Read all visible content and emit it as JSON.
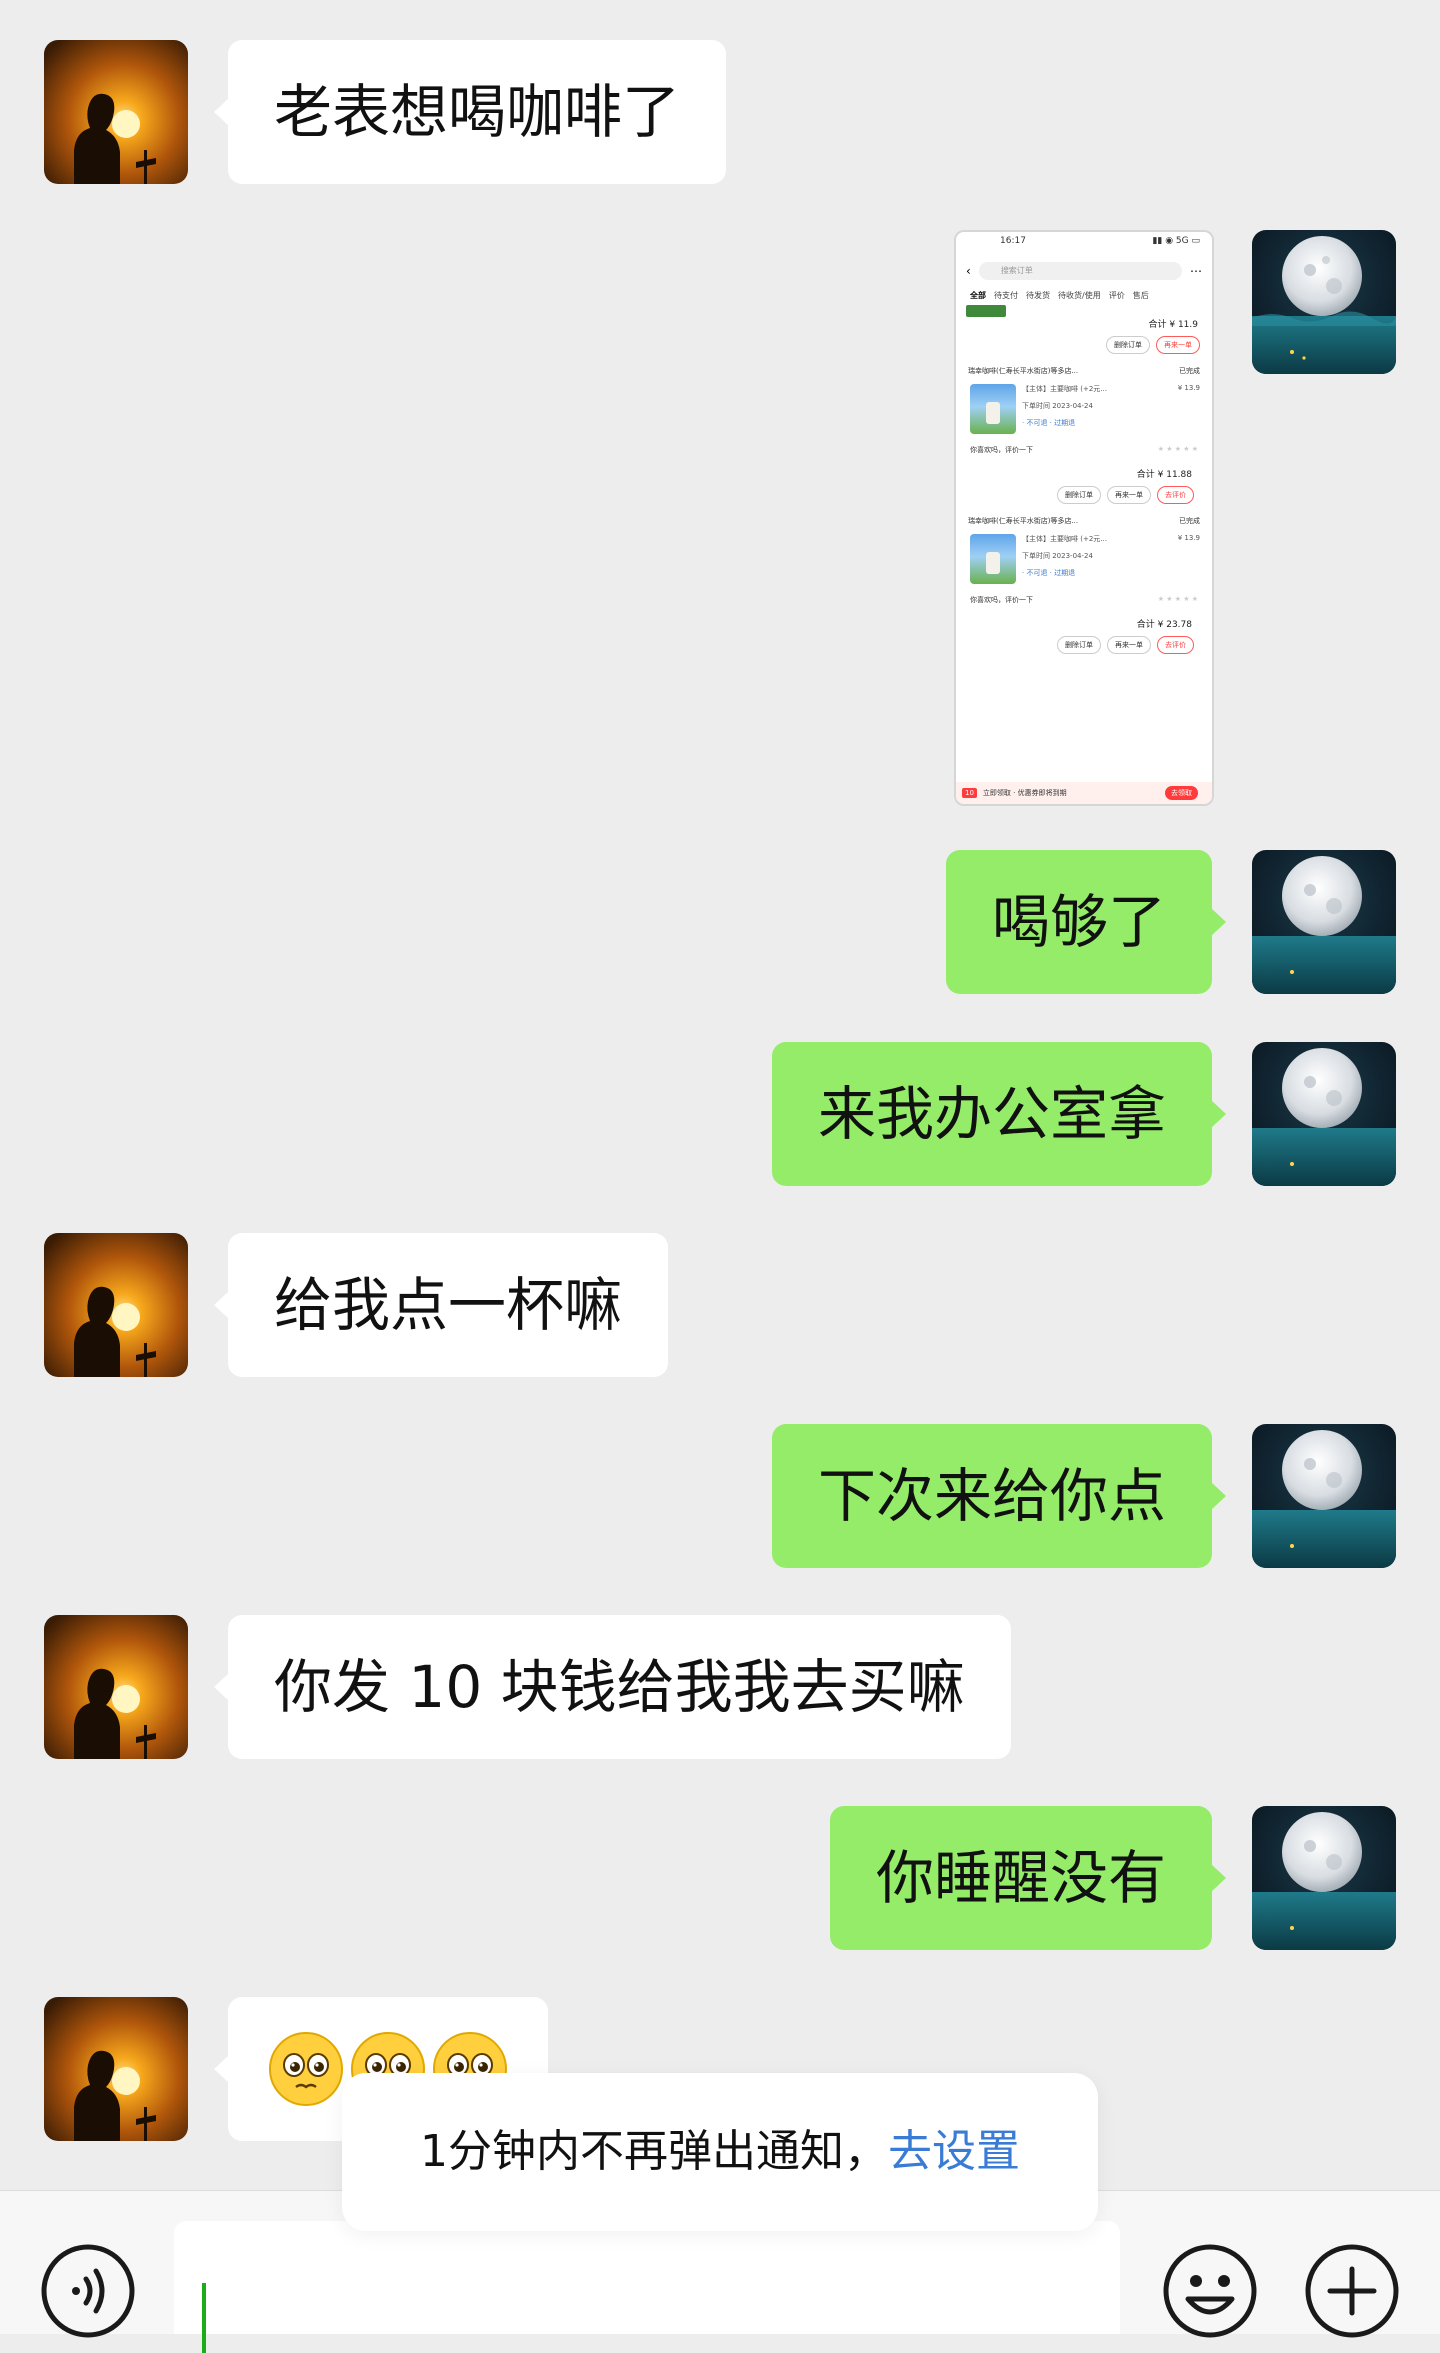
{
  "messages": [
    {
      "side": "in",
      "text": "老表想喝咖啡了"
    },
    {
      "side": "out",
      "type": "image",
      "alt": "screenshot"
    },
    {
      "side": "out",
      "text": "喝够了"
    },
    {
      "side": "out",
      "text": "来我办公室拿"
    },
    {
      "side": "in",
      "text": "给我点一杯嘛"
    },
    {
      "side": "out",
      "text": "下次来给你点"
    },
    {
      "side": "in",
      "text": "你发 10 块钱给我我去买嘛"
    },
    {
      "side": "out",
      "text": "你睡醒没有"
    },
    {
      "side": "in",
      "type": "emoji",
      "emojis": [
        "pleading-face",
        "pleading-face",
        "pleading-face"
      ]
    }
  ],
  "screenshot": {
    "tabs": [
      "全部",
      "待支付",
      "待发货",
      "待收货/使用",
      "评价",
      "售后"
    ],
    "order1_total": "合计 ¥ 11.9",
    "order1_buttons": [
      "删除订单",
      "再来一单"
    ],
    "order2_store": "瑞幸咖啡(仁寿长平水街店)等多店...",
    "order2_item": "【主体】主要咖啡 (+2元...",
    "order2_price": "¥ 13.9",
    "order2_total": "合计 ¥ 11.88",
    "order2_buttons": [
      "删除订单",
      "再来一单",
      "去评价"
    ],
    "order3_store": "瑞幸咖啡(仁寿长平水街店)等多店...",
    "order3_item": "【主体】主要咖啡 (+2元...",
    "order3_price": "¥ 13.9",
    "order3_total": "合计 ¥ 23.78",
    "order3_buttons": [
      "删除订单",
      "再来一单",
      "去评价"
    ],
    "rate_prompt": "你喜欢吗，评价一下",
    "bottom_tag": "10",
    "bottom_go": "去领取"
  },
  "toast": {
    "text": "1分钟内不再弹出通知，",
    "link": "去设置"
  },
  "input_bar": {
    "voice_icon": "voice-icon",
    "emoji_icon": "emoji-icon",
    "plus_icon": "plus-icon",
    "text": ""
  },
  "colors": {
    "background": "#ededed",
    "incoming_bubble": "#ffffff",
    "outgoing_bubble": "#95ec69",
    "link": "#3a7bd5"
  }
}
